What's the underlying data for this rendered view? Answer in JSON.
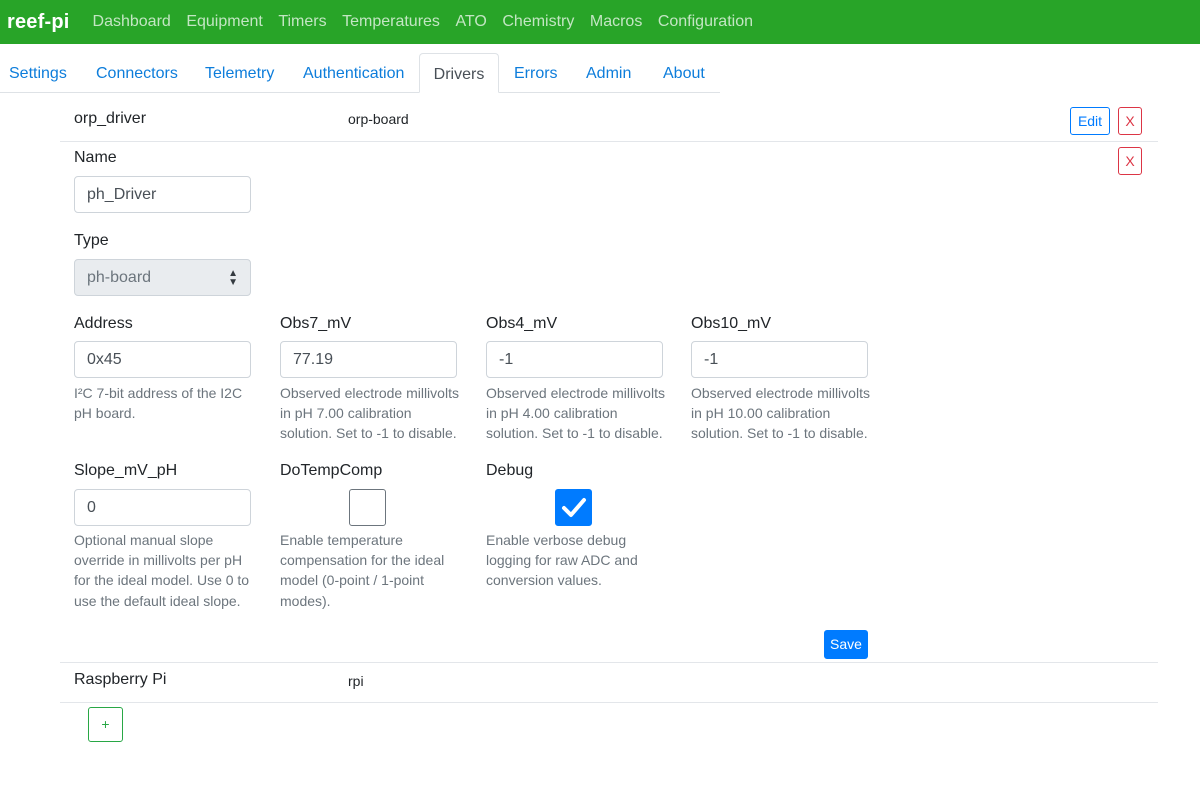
{
  "navbar": {
    "brand": "reef-pi",
    "links": [
      "Dashboard",
      "Equipment",
      "Timers",
      "Temperatures",
      "ATO",
      "Chemistry",
      "Macros",
      "Configuration"
    ]
  },
  "tabs": [
    "Settings",
    "Connectors",
    "Telemetry",
    "Authentication",
    "Drivers",
    "Errors",
    "Admin",
    "About"
  ],
  "active_tab": "Drivers",
  "drivers": [
    {
      "name": "orp_driver",
      "type": "orp-board",
      "edit_label": "Edit",
      "delete_label": "X"
    },
    {
      "name": "Raspberry Pi",
      "type": "rpi"
    }
  ],
  "form": {
    "delete_label": "X",
    "name_label": "Name",
    "name_value": "ph_Driver",
    "type_label": "Type",
    "type_value": "ph-board",
    "address": {
      "label": "Address",
      "value": "0x45",
      "help": [
        "I²C 7-bit address of the I2C",
        "pH board."
      ]
    },
    "obs7": {
      "label": "Obs7_mV",
      "value": "77.19",
      "help": [
        "Observed electrode millivolts",
        "in pH 7.00 calibration",
        "solution. Set to -1 to disable."
      ]
    },
    "obs4": {
      "label": "Obs4_mV",
      "value": "-1",
      "help": [
        "Observed electrode millivolts",
        "in pH 4.00 calibration",
        "solution. Set to -1 to disable."
      ]
    },
    "obs10": {
      "label": "Obs10_mV",
      "value": "-1",
      "help": [
        "Observed electrode millivolts",
        "in pH 10.00 calibration",
        "solution. Set to -1 to disable."
      ]
    },
    "slope": {
      "label": "Slope_mV_pH",
      "value": "0",
      "help": [
        "Optional manual slope",
        "override in millivolts per pH",
        "for the ideal model. Use 0 to",
        "use the default ideal slope."
      ]
    },
    "dotempcomp": {
      "label": "DoTempComp",
      "checked": false,
      "help": [
        "Enable temperature",
        "compensation for the ideal",
        "model (0-point / 1-point",
        "modes)."
      ]
    },
    "debug": {
      "label": "Debug",
      "checked": true,
      "help": [
        "Enable verbose debug",
        "logging for raw ADC and",
        "conversion values."
      ]
    },
    "save_label": "Save"
  },
  "add_label": "+",
  "colors": {
    "navbar": "#28a428",
    "primary": "#007bff",
    "danger": "#dc3545",
    "success": "#28a745"
  }
}
